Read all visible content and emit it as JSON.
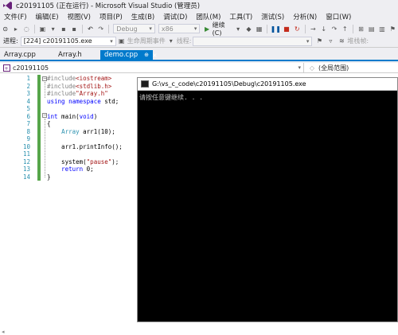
{
  "window": {
    "title": "c20191105 (正在运行) - Microsoft Visual Studio (管理员)"
  },
  "menu": [
    "文件(F)",
    "编辑(E)",
    "视图(V)",
    "项目(P)",
    "生成(B)",
    "调试(D)",
    "团队(M)",
    "工具(T)",
    "测试(S)",
    "分析(N)",
    "窗口(W)"
  ],
  "toolbar": {
    "config_value": "Debug",
    "platform_value": "x86",
    "continue_label": "继续(C)"
  },
  "debugbar": {
    "process_label": "进程:",
    "process_value": "[224] c20191105.exe",
    "lifecycle_label": "生命周期事件",
    "thread_label": "线程:",
    "stackframe_label": "堆栈帧:"
  },
  "tabs": [
    {
      "label": "Array.cpp"
    },
    {
      "label": "Array.h"
    },
    {
      "label": "demo.cpp",
      "pin": "⊕",
      "close": "×"
    }
  ],
  "navbar": {
    "project": "c20191105",
    "scope": "(全局范围)"
  },
  "editor": {
    "line_numbers": [
      "1",
      "2",
      "3",
      "4",
      "5",
      "6",
      "7",
      "8",
      "9",
      "10",
      "11",
      "12",
      "13",
      "14"
    ]
  },
  "console": {
    "title": "G:\\vs_c_code\\c20191105\\Debug\\c20191105.exe",
    "output": "请按任意键继续. . ."
  },
  "colors": {
    "accent": "#007acc",
    "change_bar": "#57a64a",
    "keyword": "#0000ff",
    "string": "#a31515",
    "type": "#2b91af"
  }
}
